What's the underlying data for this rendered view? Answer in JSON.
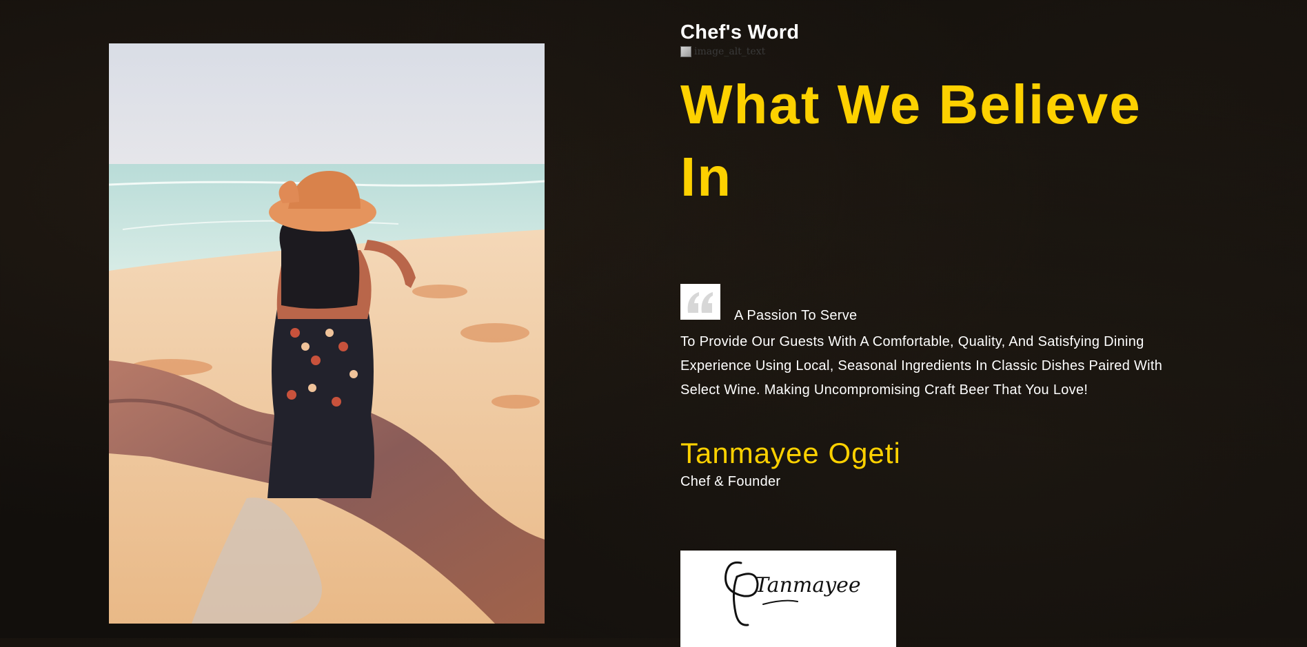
{
  "section": {
    "eyebrow": "Chef's Word",
    "broken_image_alt": "image_alt_text",
    "headline": "What We Believe In"
  },
  "quote": {
    "icon": "quote-icon",
    "title": "A Passion To Serve",
    "body": "To Provide Our Guests With A Comfortable, Quality, And Satisfying Dining Experience Using Local, Seasonal Ingredients In Classic Dishes Paired With Select Wine. Making Uncompromising Craft Beer That You Love!"
  },
  "chef": {
    "name": "Tanmayee Ogeti",
    "role": "Chef & Founder",
    "signature_text": "Tanmayee"
  },
  "colors": {
    "accent": "#fdd100",
    "background": "#120f0c",
    "text": "#ffffff"
  }
}
